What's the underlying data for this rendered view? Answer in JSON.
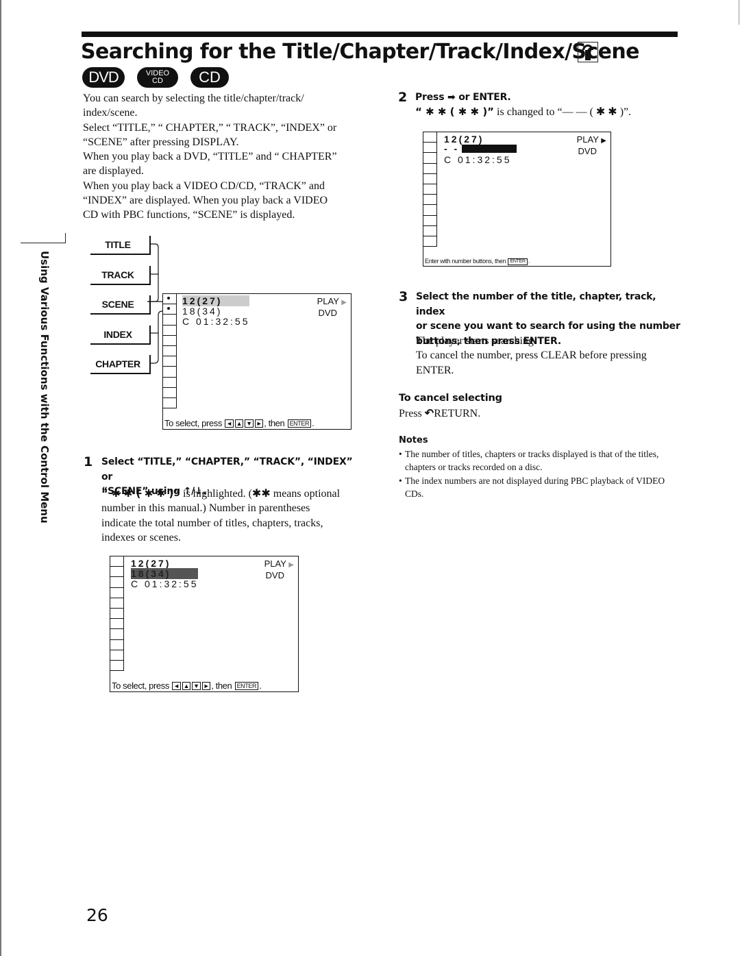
{
  "header": {
    "title": "Searching for the Title/Chapter/Track/Index/Scene",
    "title_icon": "remote-control-icon",
    "disc_badges": [
      {
        "label": "DVD",
        "icon": "dvd-badge-icon"
      },
      {
        "label_top": "VIDEO",
        "label_bottom": "CD",
        "icon": "video-cd-badge-icon"
      },
      {
        "label": "CD",
        "icon": "cd-badge-icon"
      }
    ]
  },
  "side_tab": {
    "label": "Using Various Functions with the Control Menu"
  },
  "intro": {
    "lines": [
      "You can search by selecting the title/chapter/track/",
      "index/scene.",
      "Select “TITLE,” “ CHAPTER,” “ TRACK”, “INDEX” or",
      "“SCENE” after pressing DISPLAY.",
      "When you play back a DVD,  “TITLE” and “ CHAPTER”",
      "are displayed.",
      "When you play back a VIDEO CD/CD,  “TRACK” and",
      "“INDEX” are displayed.  When you play back a VIDEO",
      "CD with PBC functions, “SCENE” is displayed."
    ]
  },
  "menu_labels": [
    "TITLE",
    "TRACK",
    "SCENE",
    "INDEX",
    "CHAPTER"
  ],
  "osd_common": {
    "line1": "12(27)",
    "line2": "18(34)",
    "line3": "C 01:32:55",
    "play": "PLAY",
    "play_icon": "▶",
    "disc": "DVD",
    "footer_prefix": "To select, press",
    "footer_keys": [
      "◄",
      "▲",
      "▼",
      "►"
    ],
    "footer_then": ", then",
    "footer_enter": "ENTER",
    "footer_end": "."
  },
  "osd_step2": {
    "line1": "12(27)",
    "line2": "- -",
    "line3": "C 01:32:55",
    "play": "PLAY",
    "disc": "DVD",
    "footer_text": "Enter with number buttons, then",
    "footer_enter": "ENTER",
    "footer_end": "."
  },
  "step1": {
    "number": "1",
    "heading_line1": "Select “TITLE,” “CHAPTER,” “TRACK”, “INDEX” or",
    "heading_line2": "“SCENE” using ↑/↓.",
    "body_ast": "“ ✱ ✱ ( ✱ ✱ )”",
    "body_line1_rest": " is highlighted.  (✱✱ means optional",
    "body_lines": [
      "number in this manual.)  Number in parentheses",
      "indicate the total number of titles, chapters, tracks,",
      "indexes or scenes."
    ]
  },
  "step2": {
    "number": "2",
    "heading": "Press ➡ or ENTER.",
    "body_from": "“ ✱ ✱ ( ✱ ✱ )”",
    "body_mid": " is changed to “— — ( ✱ ✱ )”."
  },
  "step3": {
    "number": "3",
    "heading_lines": [
      "Select the number of the title, chapter, track, index",
      "or scene you want to search for using the number",
      "buttons, then press ENTER."
    ],
    "body_lines": [
      "The player starts searching.",
      "To cancel the number, press CLEAR before pressing",
      "ENTER."
    ]
  },
  "cancel": {
    "heading": "To cancel selecting",
    "text_prefix": "Press ",
    "return_icon": "↶",
    "text_suffix": "RETURN."
  },
  "notes": {
    "heading": "Notes",
    "items": [
      "The number of titles, chapters or tracks displayed is that of the titles, chapters or tracks recorded on a disc.",
      "The index numbers are not displayed during PBC playback of VIDEO CDs."
    ]
  },
  "page_number": "26"
}
